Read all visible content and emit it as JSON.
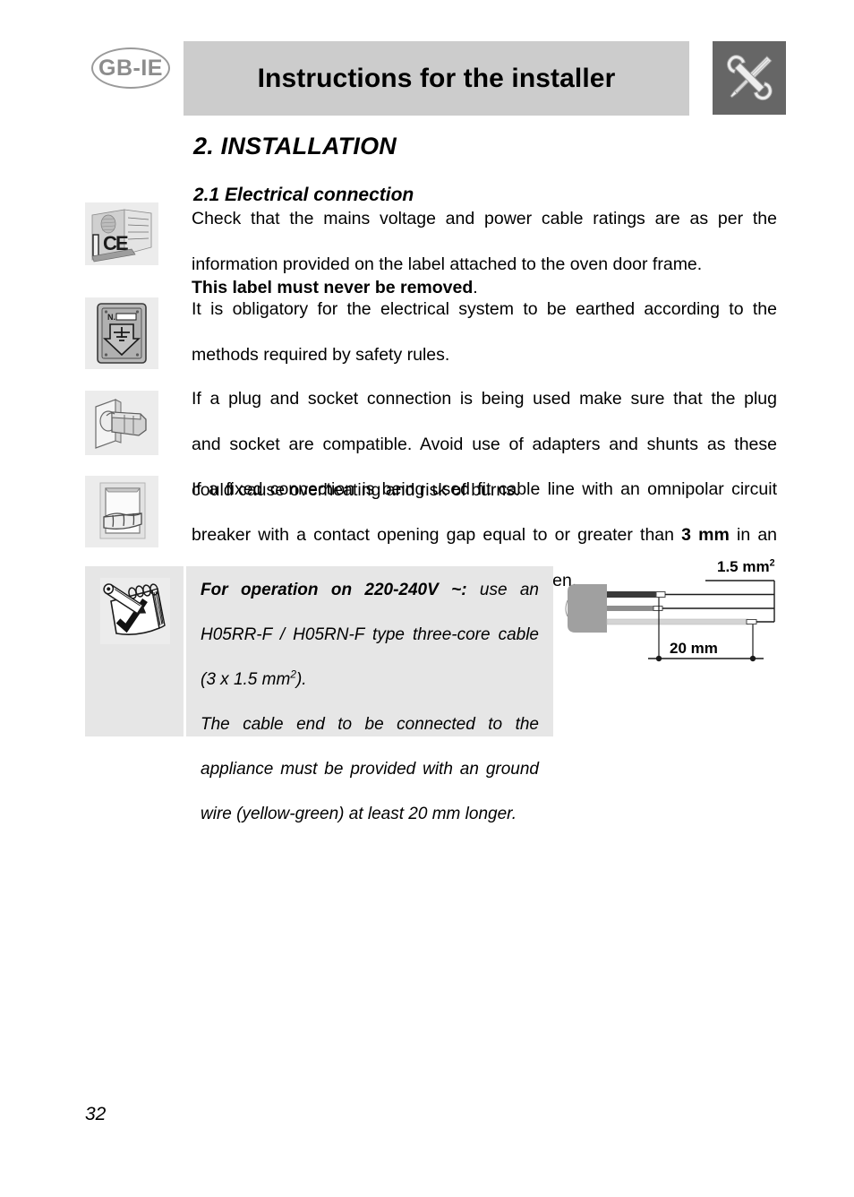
{
  "header": {
    "language_badge": "GB-IE",
    "title": "Instructions for the installer",
    "icon": "tools-icon",
    "band_color": "#cccccc",
    "icon_box_color": "#666666"
  },
  "section": {
    "number_and_title": "2.  INSTALLATION",
    "subsection_title": "2.1 Electrical connection"
  },
  "paragraphs": [
    {
      "icon": "rating-label-ce-icon",
      "lines": [
        "Check  that  the  mains  voltage  and  power  cable  ratings  are  as  per  the",
        "information provided on the label attached to the oven door frame."
      ],
      "bold_line": "This label must never be removed",
      "bold_line_tail": "."
    },
    {
      "icon": "earthing-plate-icon",
      "lines": [
        "It  is  obligatory  for  the  electrical  system  to  be  earthed  according  to  the",
        "methods required by safety rules."
      ]
    },
    {
      "icon": "plug-socket-icon",
      "lines": [
        "If  a  plug  and  socket  connection  is  being  used  make  sure  that  the  plug",
        "and  socket  are  compatible.  Avoid  use  of  adapters  and  shunts  as  these",
        "could cause overheating and risk of burns."
      ]
    },
    {
      "icon": "wall-switch-icon",
      "line_1_pre": "If a fixed connection is being used fit cable line with an omnipolar circuit",
      "line_2_pre": "breaker with a contact opening gap equal to or greater than ",
      "line_2_bold": "3 mm",
      "line_2_post": " in an",
      "line_3": "easily accessible position in proximity to the oven."
    }
  ],
  "note": {
    "icon": "notepad-pencil-check-icon",
    "panel_color": "#e6e6e6",
    "paragraph_1": {
      "bold_lead": "For  operation  on  220-240V  ~:",
      "rest_line_1": " use  an",
      "line_2": "H05RR-F / H05RN-F type three-core cable",
      "line_3_pre": "(3 x 1.5 mm",
      "line_3_sup": "2",
      "line_3_post": ")."
    },
    "paragraph_2": {
      "line_1": "The   cable   end   to   be   connected   to   the",
      "line_2": "appliance  must  be  provided  with  an  ground",
      "line_3": "wire (yellow-green) at least 20 mm longer."
    }
  },
  "diagram": {
    "name": "three-core-cable-diagram",
    "label_cross_section": "1.5 mm",
    "label_cross_section_sup": "2",
    "label_length": "20 mm",
    "wires": [
      {
        "name": "live-wire",
        "color": "#3a3a3a"
      },
      {
        "name": "neutral-wire",
        "color": "#8d8d8d"
      },
      {
        "name": "ground-wire",
        "color": "#d4d4d4"
      }
    ],
    "sheath_color": "#a0a0a0"
  },
  "footer": {
    "page_number": "32"
  }
}
